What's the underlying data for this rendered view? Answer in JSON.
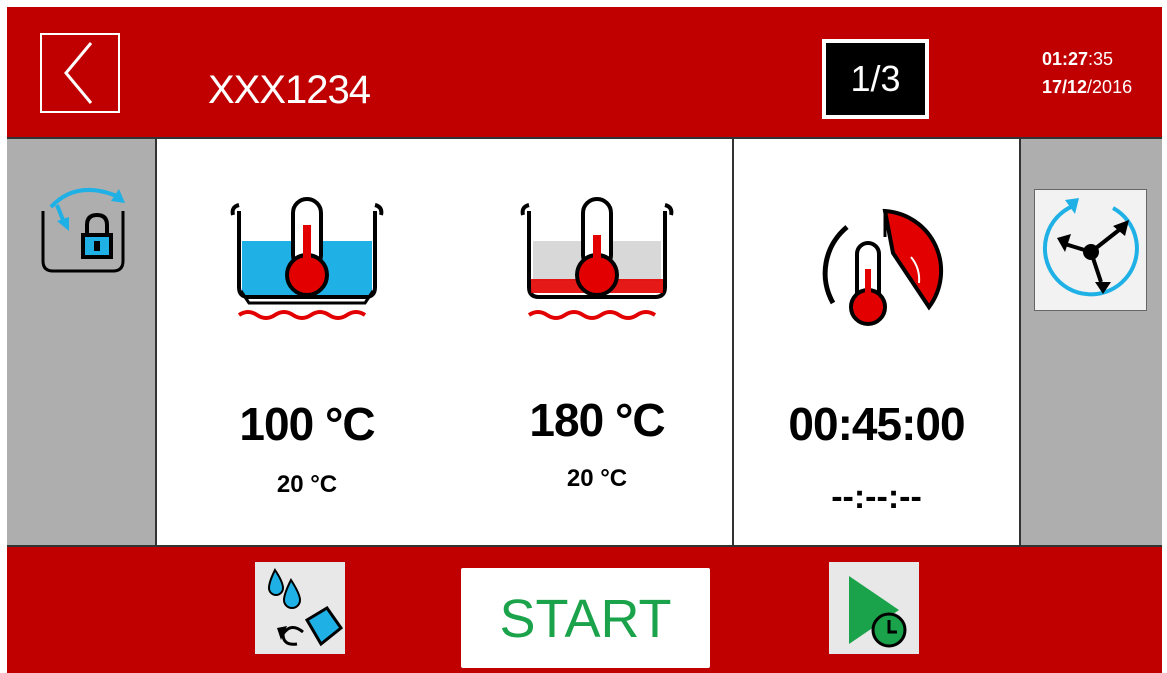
{
  "header": {
    "title": "XXX1234",
    "page_indicator": "1/3",
    "time_hm": "01:27",
    "time_s": ":35",
    "date_dm": "17/12",
    "date_y": "/2016"
  },
  "bath": {
    "setpoint": "100 °C",
    "actual": "20 °C"
  },
  "fry": {
    "setpoint": "180 °C",
    "actual": "20 °C"
  },
  "timer": {
    "setpoint": "00:45:00",
    "remaining": "--:--:--"
  },
  "footer": {
    "start_label": "START"
  },
  "colors": {
    "frame": "#c00000",
    "side": "#aeaeae",
    "water": "#1fb1e6",
    "heat": "#e30000",
    "start_text": "#1aa34a"
  },
  "icons": [
    "back-arrow-icon",
    "lid-lock-icon",
    "water-bath-thermometer-icon",
    "fry-heat-thermometer-icon",
    "timer-thermometer-icon",
    "rotation-mixer-icon",
    "drain-fill-icon",
    "delayed-start-icon"
  ]
}
